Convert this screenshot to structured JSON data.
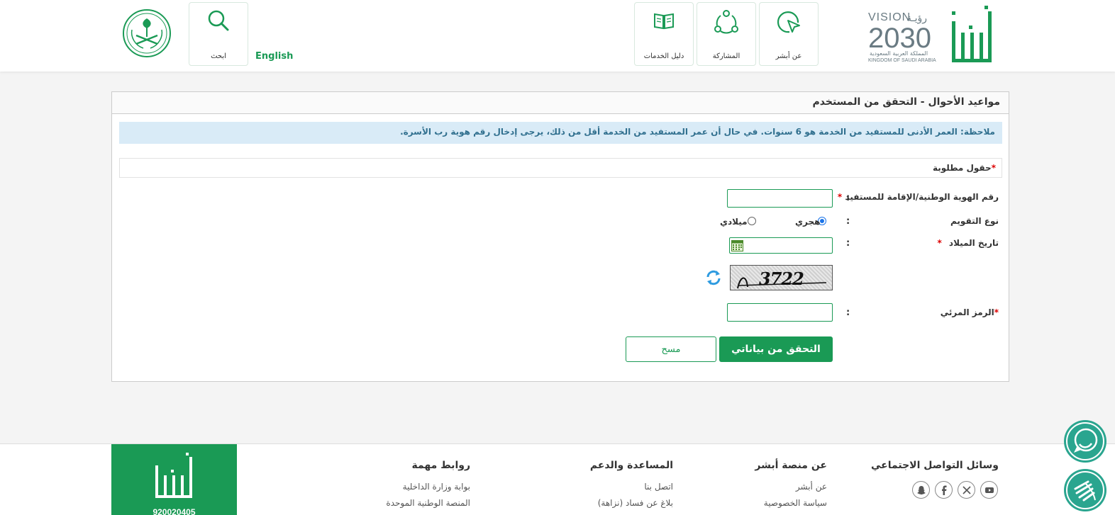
{
  "header": {
    "brand_name": "أبشر",
    "vision": {
      "title_en": "VISION",
      "title_ar": "رؤيـة",
      "year": "2030",
      "country_ar": "المملكة العربية السعودية",
      "country_en": "KINGDOM OF SAUDI ARABIA"
    },
    "nav": [
      {
        "label": "عن أبشر",
        "icon": "cursor-click-icon"
      },
      {
        "label": "المشاركة",
        "icon": "share-network-icon"
      },
      {
        "label": "دليل الخدمات",
        "icon": "book-icon"
      }
    ],
    "search_label": "ابحث",
    "language_link": "English",
    "emblem": "saudi-emblem"
  },
  "page": {
    "title": "مواعيد الأحوال - التحقق من المستخدم",
    "note": "ملاحظة: العمر الأدنى للمستفيد من الخدمة هو 6 سنوات. في حال أن عمر المستفيد من الخدمة أقل من ذلك، يرجى إدخال رقم هوية رب الأسرة.",
    "required_star": "*",
    "required_note": "حقول مطلوبة"
  },
  "form": {
    "id_label": "رقم الهوية الوطنية/الإقامة للمستفيد",
    "id_value": "",
    "calendar_label": "نوع التقويم",
    "calendar_options": [
      "هجري",
      "ميلادي"
    ],
    "calendar_selected": "هجري",
    "birthdate_label": "تاريخ الميلاد",
    "birthdate_value": "",
    "captcha_text": "3722",
    "visual_code_label": "الرمز المرئي",
    "visual_code_value": "",
    "colon": ":",
    "submit_label": "التحقق من بياناتي",
    "clear_label": "مسح"
  },
  "footer": {
    "brand_name": "أبشر",
    "phone": "920020405",
    "columns": [
      {
        "heading": "وسائل التواصل الاجتماعي",
        "items": []
      },
      {
        "heading": "عن منصة أبشر",
        "items": [
          "عن أبشر",
          "سياسة الخصوصية"
        ]
      },
      {
        "heading": "المساعدة والدعم",
        "items": [
          "اتصل بنا",
          "بلاغ عن فساد (نزاهة)"
        ]
      },
      {
        "heading": "روابط مهمة",
        "items": [
          "بوابة وزارة الداخلية",
          "المنصة الوطنية الموحدة"
        ]
      }
    ],
    "social_icons": [
      "youtube-icon",
      "x-icon",
      "facebook-icon",
      "snapchat-icon"
    ]
  },
  "colors": {
    "brand_green": "#1a9a55",
    "note_bg": "#d9ebf7",
    "note_text": "#31708f",
    "required_red": "#dd0000",
    "teal": "#2aa58f"
  }
}
